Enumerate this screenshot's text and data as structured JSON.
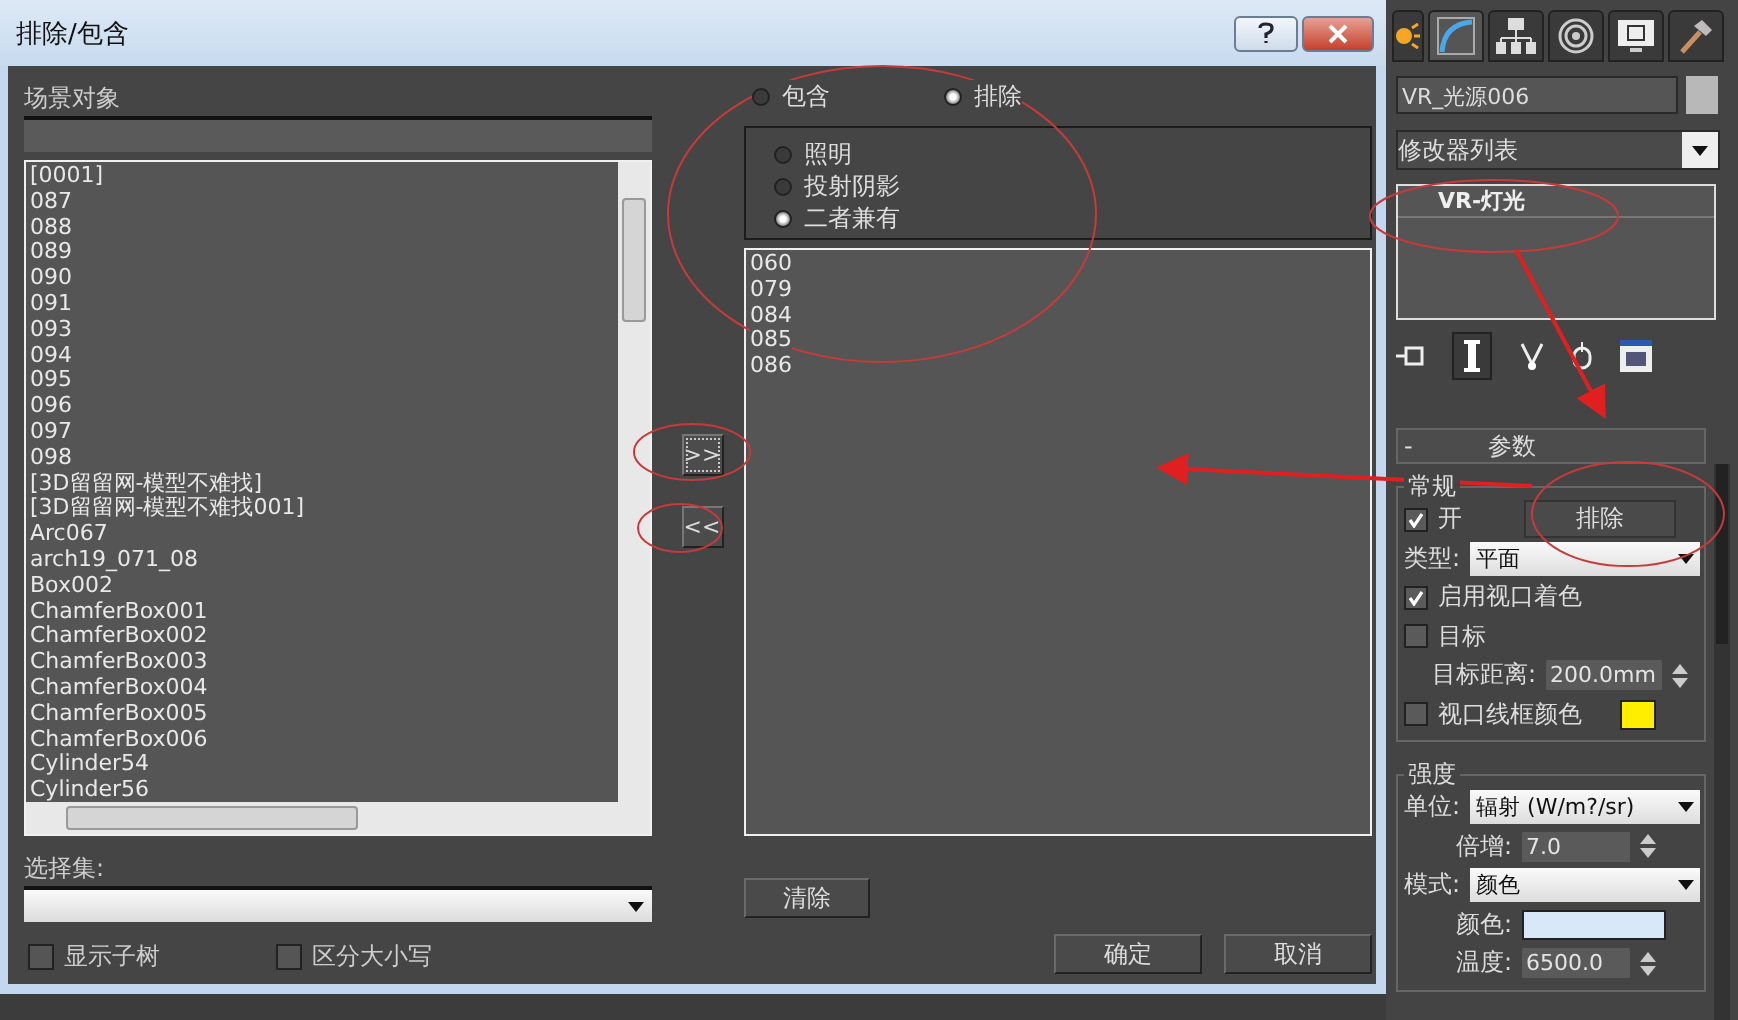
{
  "dialog": {
    "title": "排除/包含",
    "scene_objects": {
      "label": "场景对象",
      "items": [
        "[0001]",
        "087",
        "088",
        "089",
        "090",
        "091",
        "093",
        "094",
        "095",
        "096",
        "097",
        "098",
        "[3D留留网-模型不难找]",
        "[3D留留网-模型不难找001]",
        "Arc067",
        "arch19_071_08",
        "Box002",
        "ChamferBox001",
        "ChamferBox002",
        "ChamferBox003",
        "ChamferBox004",
        "ChamferBox005",
        "ChamferBox006",
        "Cylinder54",
        "Cylinder56"
      ]
    },
    "selection_set": {
      "label": "选择集:"
    },
    "checkboxes": [
      {
        "label": "显示子树",
        "checked": false
      },
      {
        "label": "区分大小写",
        "checked": false
      }
    ],
    "move_buttons": [
      ">>",
      "<<"
    ],
    "mode_radios": [
      {
        "label": "包含",
        "selected": false
      },
      {
        "label": "排除",
        "selected": true
      }
    ],
    "type_radios": [
      {
        "label": "照明",
        "selected": false
      },
      {
        "label": "投射阴影",
        "selected": false
      },
      {
        "label": "二者兼有",
        "selected": true
      }
    ],
    "excluded_items": [
      "060",
      "079",
      "084",
      "085",
      "086"
    ],
    "clear_button": "清除",
    "buttons": [
      "确定",
      "取消"
    ]
  },
  "command_panel": {
    "object_name": "VR_光源006",
    "modifier_list": "修改器列表",
    "stack_items": [
      "VR-灯光"
    ],
    "rollout_toggle": "-",
    "rollout_title": "参数",
    "general": {
      "title": "常规",
      "on": {
        "label": "开",
        "checked": true
      },
      "exclude_button": "排除",
      "type_label": "类型:",
      "type_value": "平面",
      "options": [
        {
          "label": "启用视口着色",
          "checked": true
        },
        {
          "label": "目标",
          "checked": false
        }
      ],
      "target_distance": {
        "label": "目标距离:",
        "value": "200.0mm"
      },
      "wireframe": {
        "label": "视口线框颜色",
        "checked": false,
        "color": "#ffee00"
      }
    },
    "intensity": {
      "title": "强度",
      "rows": [
        {
          "kind": "dropdown",
          "label": "单位:",
          "value": "辐射 (W/m?/sr)"
        },
        {
          "kind": "spinner",
          "label": "倍增:",
          "value": "7.0"
        },
        {
          "kind": "dropdown",
          "label": "模式:",
          "value": "颜色"
        },
        {
          "kind": "swatch",
          "label": "颜色:",
          "color": "#d8e8f8"
        },
        {
          "kind": "spinner",
          "label": "温度:",
          "value": "6500.0"
        }
      ]
    }
  }
}
